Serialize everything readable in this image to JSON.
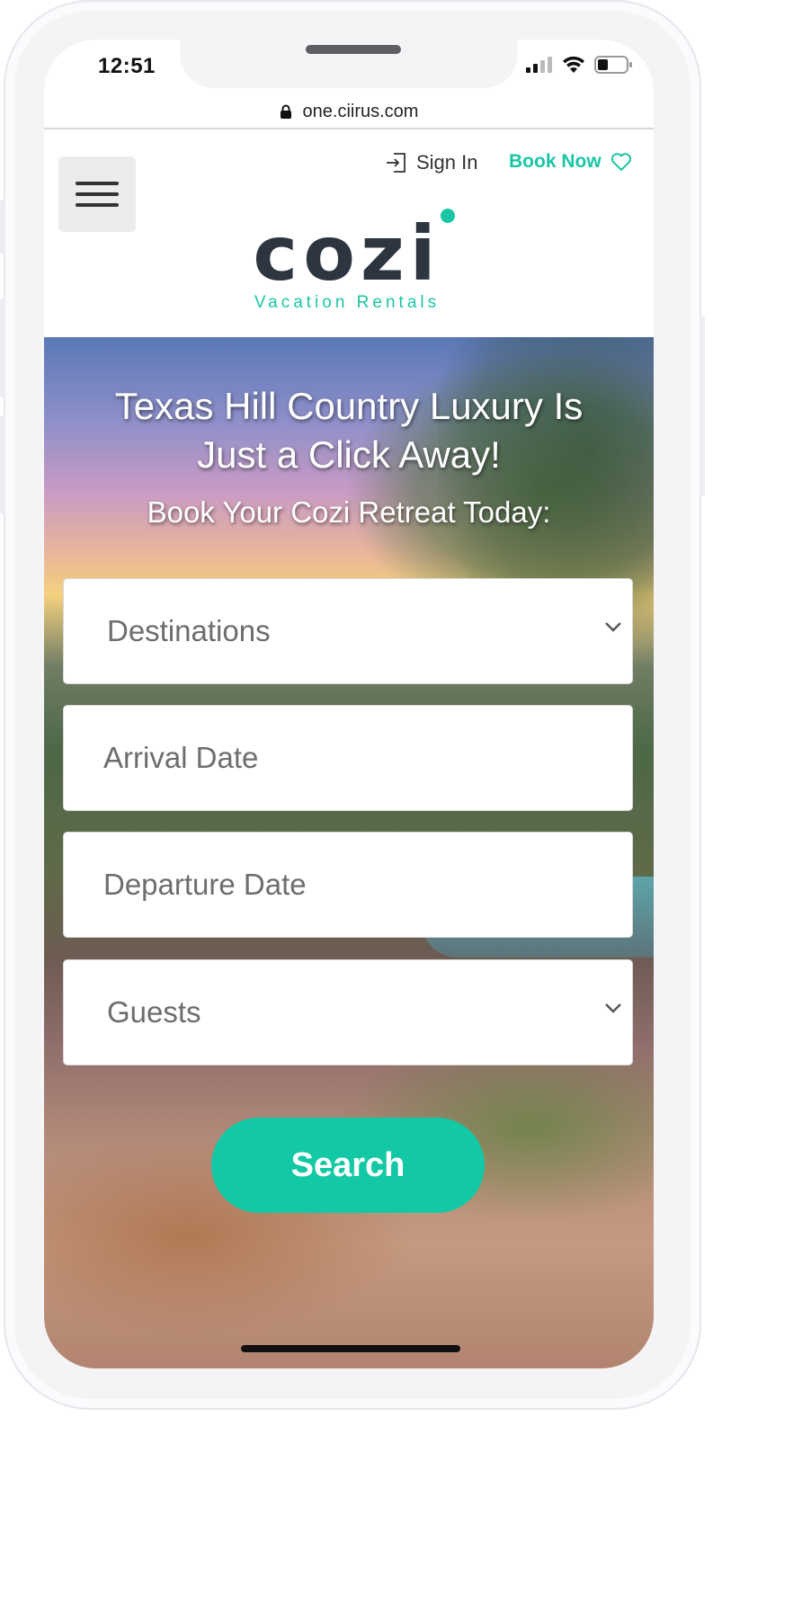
{
  "status_bar": {
    "time": "12:51"
  },
  "browser": {
    "url": "one.ciirus.com"
  },
  "header": {
    "sign_in_label": "Sign In",
    "book_now_label": "Book Now",
    "logo": {
      "word": "cozi",
      "tagline": "Vacation Rentals"
    }
  },
  "hero": {
    "title": "Texas Hill Country Luxury Is Just a Click Away!",
    "subtitle": "Book Your Cozi Retreat Today:"
  },
  "search_form": {
    "destinations_placeholder": "Destinations",
    "arrival_placeholder": "Arrival Date",
    "departure_placeholder": "Departure Date",
    "guests_placeholder": "Guests",
    "search_label": "Search"
  },
  "colors": {
    "accent": "#13c8a5",
    "logo_text": "#2c3540"
  },
  "icons": {
    "lock": "lock-icon",
    "sign_in": "sign-in-icon",
    "favorite": "heart-icon",
    "menu": "hamburger-menu-icon",
    "dropdown": "chevron-down-icon"
  }
}
